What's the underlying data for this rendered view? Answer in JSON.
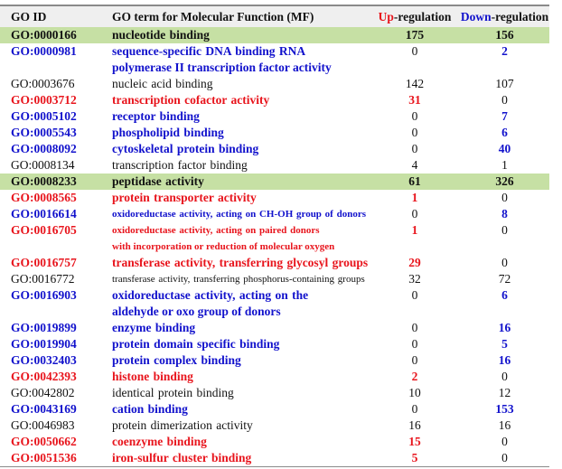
{
  "header": {
    "go_id": "GO ID",
    "go_term": "GO term for Molecular Function (MF)",
    "up_prefix": "Up",
    "up_suffix": "-regulation",
    "down_prefix": "Down",
    "down_suffix": "-regulation"
  },
  "colors": {
    "up": "#e8141c",
    "down": "#1212cc",
    "highlight": "#c6e0a4",
    "header_bg": "#efefef"
  },
  "rows": [
    {
      "id": "GO:0000166",
      "term": "nucleotide binding",
      "term2": "",
      "up": "175",
      "down": "156",
      "style": "highlight"
    },
    {
      "id": "GO:0000981",
      "term": "sequence-specific DNA binding RNA",
      "term2": "polymerase II transcription factor activity",
      "up": "0",
      "down": "2",
      "style": "blue"
    },
    {
      "id": "GO:0003676",
      "term": "nucleic acid binding",
      "term2": "",
      "up": "142",
      "down": "107",
      "style": "black"
    },
    {
      "id": "GO:0003712",
      "term": "transcription cofactor activity",
      "term2": "",
      "up": "31",
      "down": "0",
      "style": "red"
    },
    {
      "id": "GO:0005102",
      "term": "receptor binding",
      "term2": "",
      "up": "0",
      "down": "7",
      "style": "blue"
    },
    {
      "id": "GO:0005543",
      "term": "phospholipid binding",
      "term2": "",
      "up": "0",
      "down": "6",
      "style": "blue"
    },
    {
      "id": "GO:0008092",
      "term": "cytoskeletal protein binding",
      "term2": "",
      "up": "0",
      "down": "40",
      "style": "blue"
    },
    {
      "id": "GO:0008134",
      "term": "transcription factor binding",
      "term2": "",
      "up": "4",
      "down": "1",
      "style": "black"
    },
    {
      "id": "GO:0008233",
      "term": "peptidase activity",
      "term2": "",
      "up": "61",
      "down": "326",
      "style": "highlight"
    },
    {
      "id": "GO:0008565",
      "term": "protein transporter activity",
      "term2": "",
      "up": "1",
      "down": "0",
      "style": "red"
    },
    {
      "id": "GO:0016614",
      "term": "oxidoreductase activity, acting on CH-OH group of donors",
      "term2": "",
      "up": "0",
      "down": "8",
      "style": "blue-small"
    },
    {
      "id": "GO:0016705",
      "term": "oxidoreductase activity, acting on paired donors",
      "term2": "with incorporation or reduction of molecular oxygen",
      "up": "1",
      "down": "0",
      "style": "red-small"
    },
    {
      "id": "GO:0016757",
      "term": "transferase activity, transferring glycosyl groups",
      "term2": "",
      "up": "29",
      "down": "0",
      "style": "red"
    },
    {
      "id": "GO:0016772",
      "term": "transferase activity, transferring phosphorus-containing groups",
      "term2": "",
      "up": "32",
      "down": "72",
      "style": "black-small"
    },
    {
      "id": "GO:0016903",
      "term": "oxidoreductase activity, acting on the",
      "term2": "aldehyde or oxo group of donors",
      "up": "0",
      "down": "6",
      "style": "blue"
    },
    {
      "id": "GO:0019899",
      "term": "enzyme binding",
      "term2": "",
      "up": "0",
      "down": "16",
      "style": "blue"
    },
    {
      "id": "GO:0019904",
      "term": "protein domain specific binding",
      "term2": "",
      "up": "0",
      "down": "5",
      "style": "blue"
    },
    {
      "id": "GO:0032403",
      "term": "protein complex binding",
      "term2": "",
      "up": "0",
      "down": "16",
      "style": "blue"
    },
    {
      "id": "GO:0042393",
      "term": "histone binding",
      "term2": "",
      "up": "2",
      "down": "0",
      "style": "red"
    },
    {
      "id": "GO:0042802",
      "term": "identical protein binding",
      "term2": "",
      "up": "10",
      "down": "12",
      "style": "black"
    },
    {
      "id": "GO:0043169",
      "term": "cation binding",
      "term2": "",
      "up": "0",
      "down": "153",
      "style": "blue"
    },
    {
      "id": "GO:0046983",
      "term": "protein dimerization activity",
      "term2": "",
      "up": "16",
      "down": "16",
      "style": "black"
    },
    {
      "id": "GO:0050662",
      "term": "coenzyme binding",
      "term2": "",
      "up": "15",
      "down": "0",
      "style": "red"
    },
    {
      "id": "GO:0051536",
      "term": "iron-sulfur cluster binding",
      "term2": "",
      "up": "5",
      "down": "0",
      "style": "red"
    }
  ]
}
